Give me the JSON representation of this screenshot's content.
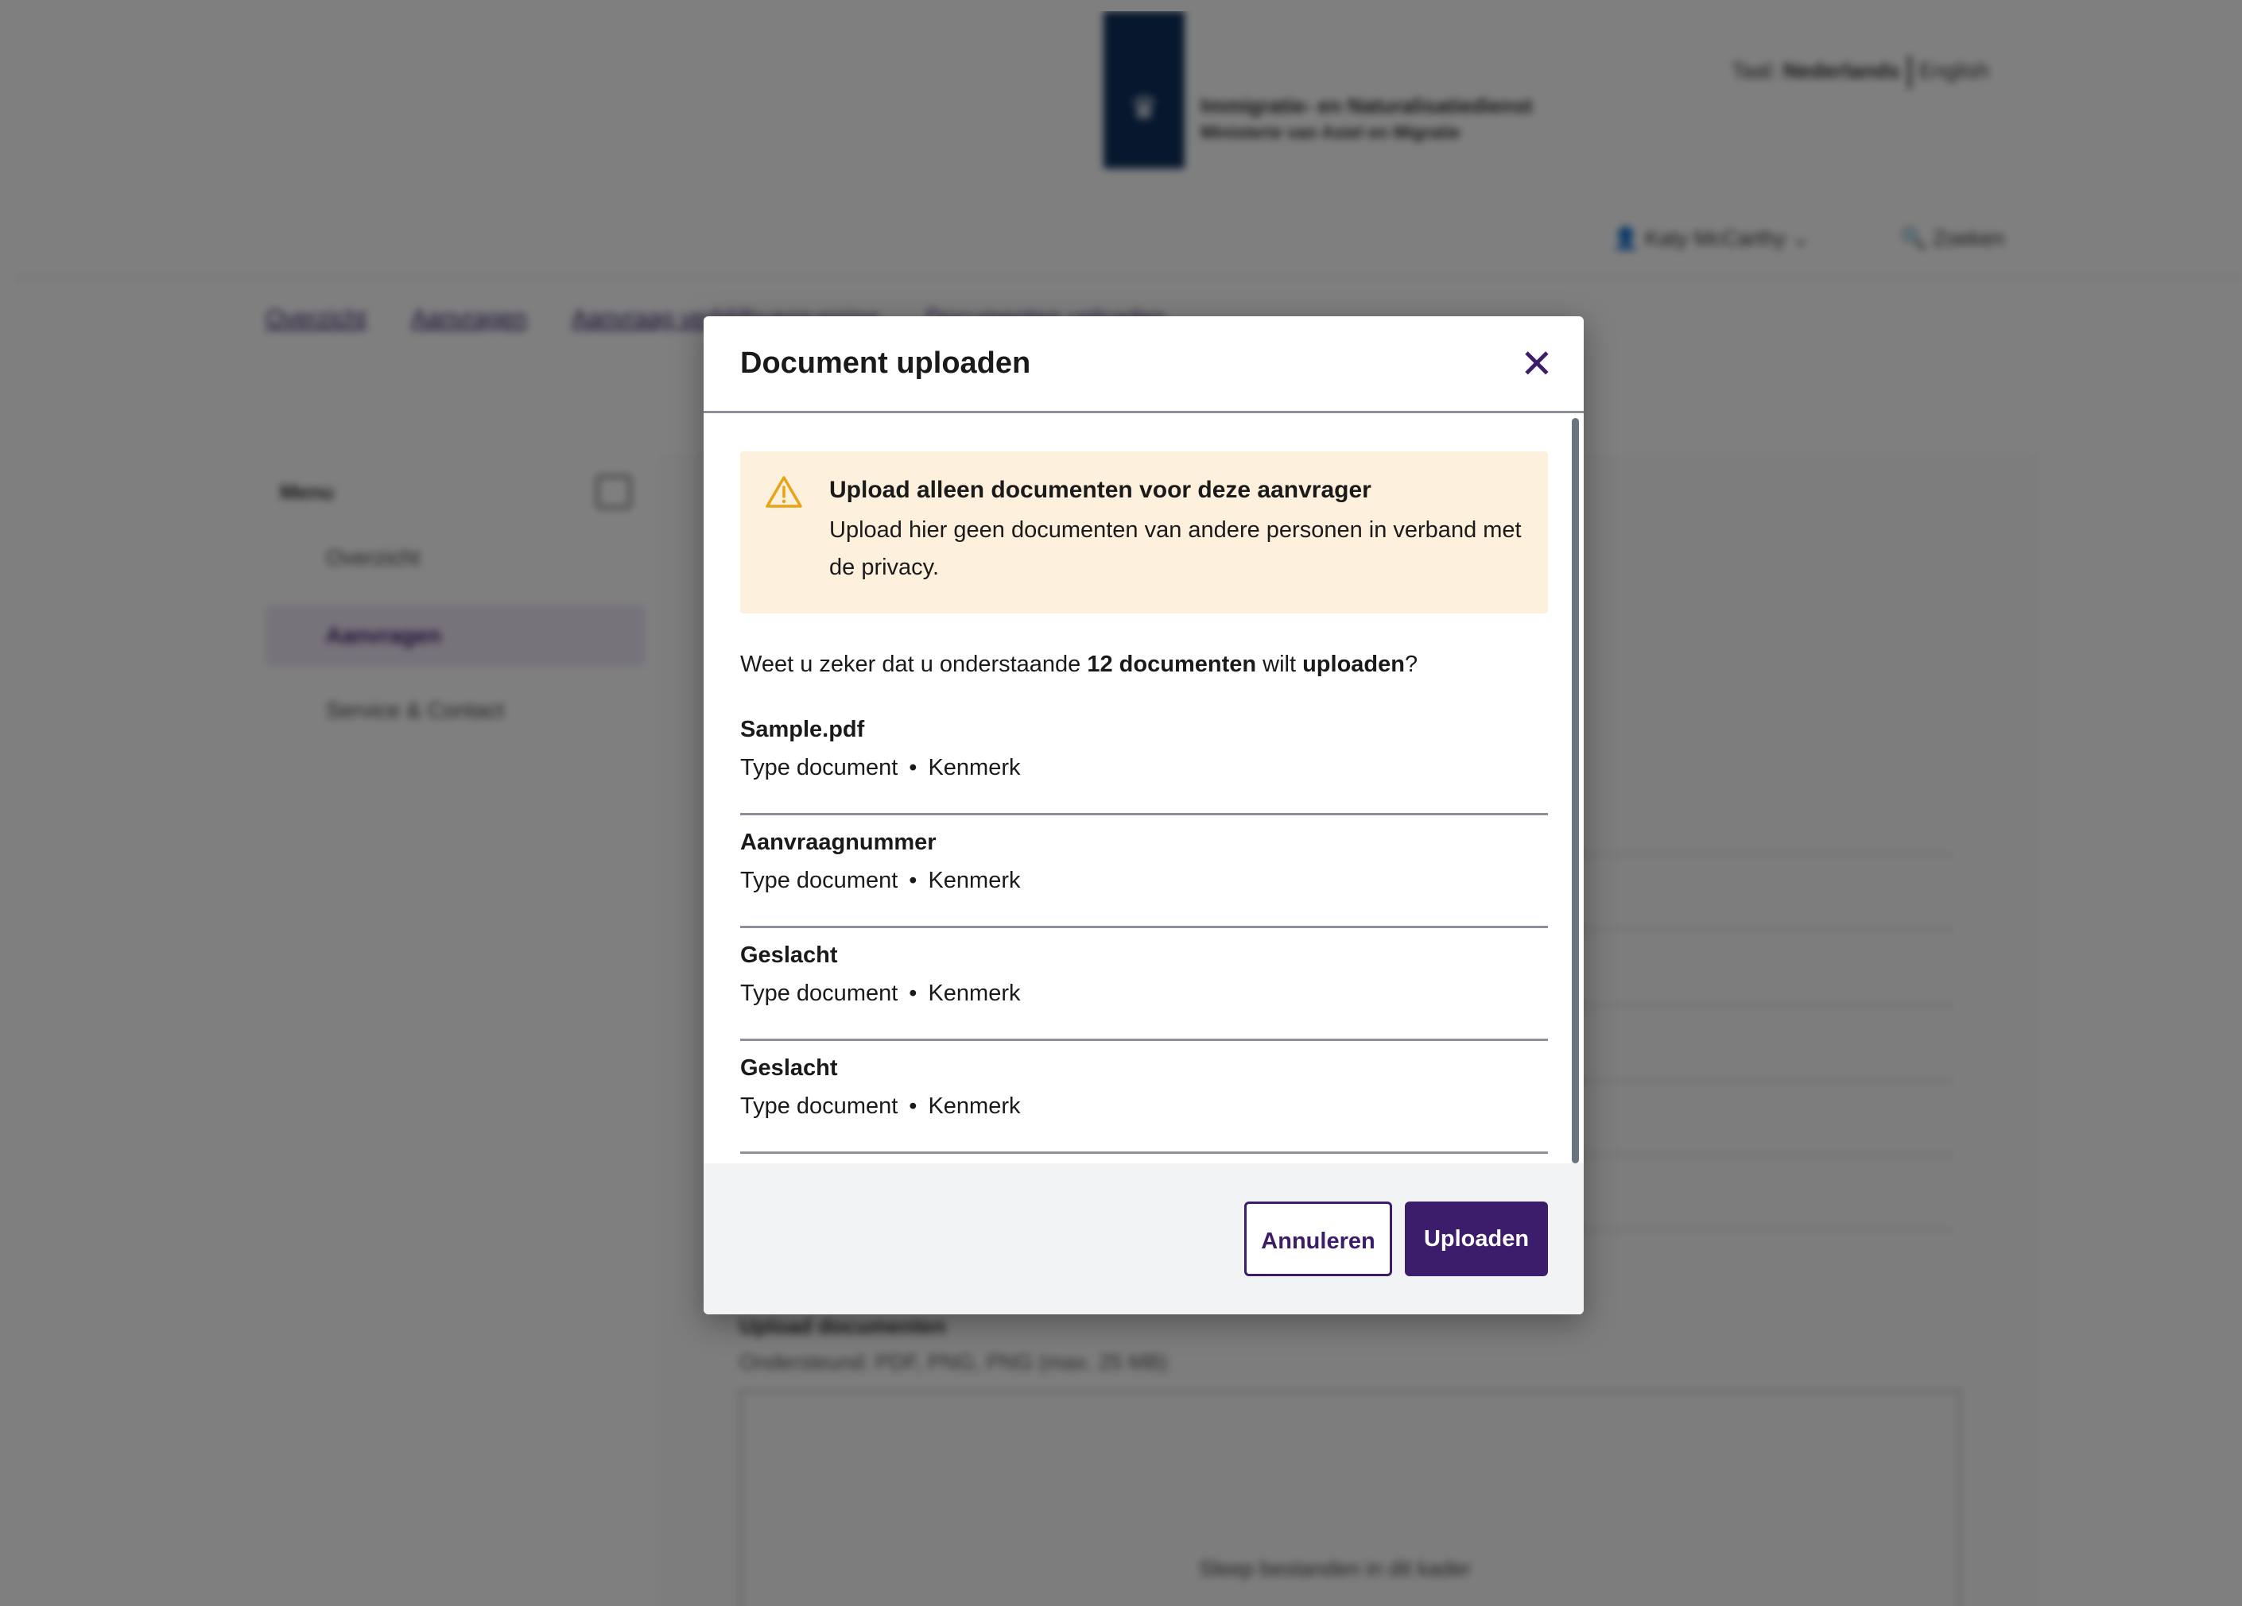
{
  "header": {
    "org_line1": "Immigratie- en Naturalisatiedienst",
    "org_line2": "Ministerie van Asiel en Migratie",
    "lang_label": "Taal:",
    "lang_active": "Nederlands",
    "lang_other": "English",
    "user_name": "Katy McCarthy",
    "search_label": "Zoeken"
  },
  "breadcrumb": [
    "Overzicht",
    "Aanvragen",
    "Aanvraag verblijfsvergunning",
    "Documenten uploaden"
  ],
  "sidebar": {
    "title": "Menu",
    "items": [
      {
        "label": "Overzicht",
        "icon": "grid-icon"
      },
      {
        "label": "Aanvragen",
        "icon": "folder-icon",
        "active": true
      },
      {
        "label": "Service & Contact",
        "icon": "phone-icon"
      }
    ]
  },
  "background_upload": {
    "title": "Upload documenten",
    "subtitle": "Ondersteund: PDF, PNG, PNG (max. 25 MB)",
    "drop_text": "Sleep bestanden in dit kader"
  },
  "modal": {
    "title": "Document uploaden",
    "close_icon": "close-icon",
    "alert": {
      "icon": "warning-icon",
      "title": "Upload alleen documenten voor deze aanvrager",
      "text": "Upload hier geen documenten van andere personen in verband met de privacy."
    },
    "confirm": {
      "prefix": "Weet u zeker dat u onderstaande ",
      "count": "12 documenten",
      "middle": " wilt ",
      "action": "uploaden",
      "suffix": "?"
    },
    "documents": [
      {
        "name": "Sample.pdf",
        "type": "Type document",
        "ref": "Kenmerk"
      },
      {
        "name": "Aanvraagnummer",
        "type": "Type document",
        "ref": "Kenmerk"
      },
      {
        "name": "Geslacht",
        "type": "Type document",
        "ref": "Kenmerk"
      },
      {
        "name": "Geslacht",
        "type": "Type document",
        "ref": "Kenmerk"
      }
    ],
    "buttons": {
      "cancel": "Annuleren",
      "upload": "Uploaden"
    }
  },
  "colors": {
    "brand_purple": "#3b1d6b",
    "alert_bg": "#fdf0dc",
    "warning": "#e8a317",
    "logo_blue": "#0c2f5c"
  }
}
